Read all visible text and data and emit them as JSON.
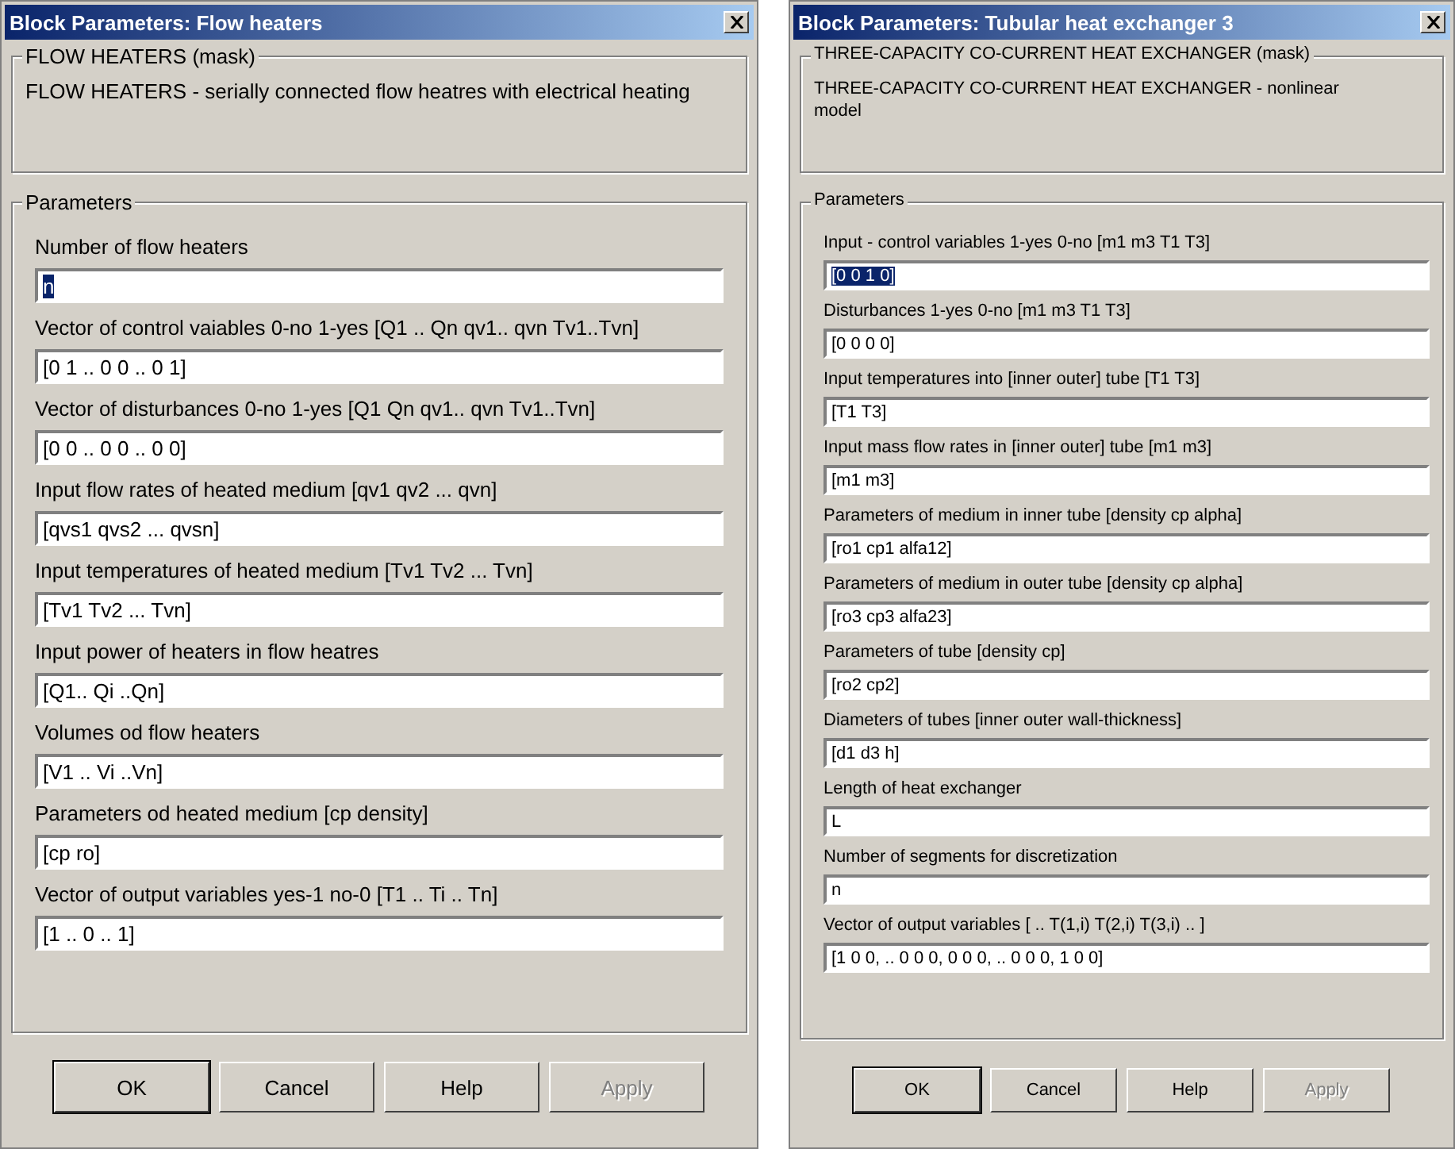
{
  "dialogs": [
    {
      "title": "Block Parameters: Flow heaters",
      "mask_title": "FLOW HEATERS (mask)",
      "mask_description": "FLOW HEATERS - serially connected flow heatres with electrical heating",
      "parameters_title": "Parameters",
      "parameters": [
        {
          "label": "Number of flow heaters",
          "value": "n",
          "text_selected": true
        },
        {
          "label": "Vector of control vaiables  0-no  1-yes [Q1 .. Qn qv1.. qvn Tv1..Tvn]",
          "value": "[0 1 .. 0 0 .. 0 1]",
          "text_selected": false
        },
        {
          "label": "Vector of disturbances  0-no 1-yes [Q1  Qn qv1.. qvn Tv1..Tvn]",
          "value": "[0 0 .. 0 0 .. 0 0]",
          "text_selected": false
        },
        {
          "label": "Input flow rates of heated medium   [qv1 qv2 ... qvn]",
          "value": "[qvs1 qvs2 ... qvsn]",
          "text_selected": false
        },
        {
          "label": "Input temperatures of heated medium    [Tv1 Tv2 ... Tvn]",
          "value": "[Tv1 Tv2 ... Tvn]",
          "text_selected": false
        },
        {
          "label": "Input power of heaters in flow heatres",
          "value": "[Q1.. Qi ..Qn]",
          "text_selected": false
        },
        {
          "label": "Volumes od flow heaters",
          "value": "[V1 .. Vi ..Vn]",
          "text_selected": false
        },
        {
          "label": "Parameters od heated medium   [cp  density]",
          "value": "[cp ro]",
          "text_selected": false
        },
        {
          "label": "Vector of output variables  yes-1  no-0   [T1 .. Ti .. Tn]",
          "value": "[1 .. 0 ..  1]",
          "text_selected": false
        }
      ],
      "buttons": [
        {
          "label": "OK",
          "disabled": false,
          "default": true
        },
        {
          "label": "Cancel",
          "disabled": false,
          "default": false
        },
        {
          "label": "Help",
          "disabled": false,
          "default": false
        },
        {
          "label": "Apply",
          "disabled": true,
          "default": false
        }
      ]
    },
    {
      "title": "Block Parameters: Tubular heat exchanger 3",
      "mask_title": "THREE-CAPACITY CO-CURRENT HEAT EXCHANGER  (mask)",
      "mask_description": "THREE-CAPACITY CO-CURRENT HEAT EXCHANGER - nonlinear model",
      "parameters_title": "Parameters",
      "parameters": [
        {
          "label": "Input - control variables   1-yes  0-no    [m1 m3 T1 T3]",
          "value": "[0 0 1 0]",
          "text_selected": true
        },
        {
          "label": "Disturbances    1-yes  0-no    [m1 m3 T1 T3]",
          "value": "[0 0 0 0]",
          "text_selected": false
        },
        {
          "label": "Input temperatures into [inner outer] tube  [T1    T3]",
          "value": "[T1 T3]",
          "text_selected": false
        },
        {
          "label": "Input mass flow rates in [inner outer] tube  [m1   m3]",
          "value": "[m1  m3]",
          "text_selected": false
        },
        {
          "label": "Parameters of medium in inner tube  [density  cp  alpha]",
          "value": "[ro1 cp1 alfa12]",
          "text_selected": false
        },
        {
          "label": "Parameters of medium in outer tube  [density  cp  alpha]",
          "value": "[ro3 cp3 alfa23]",
          "text_selected": false
        },
        {
          "label": "Parameters of tube [density  cp]",
          "value": "[ro2 cp2]",
          "text_selected": false
        },
        {
          "label": "Diameters of tubes   [inner outer wall-thickness]",
          "value": "[d1 d3 h]",
          "text_selected": false
        },
        {
          "label": "Length of heat exchanger",
          "value": "L",
          "text_selected": false
        },
        {
          "label": "Number of segments for discretization",
          "value": "n",
          "text_selected": false
        },
        {
          "label": "Vector of output variables    [ .. T(1,i)  T(2,i)  T(3,i) .. ]",
          "value": "[1 0 0, .. 0 0 0, 0 0 0, .. 0 0 0, 1 0 0]",
          "text_selected": false
        }
      ],
      "buttons": [
        {
          "label": "OK",
          "disabled": false,
          "default": true
        },
        {
          "label": "Cancel",
          "disabled": false,
          "default": false
        },
        {
          "label": "Help",
          "disabled": false,
          "default": false
        },
        {
          "label": "Apply",
          "disabled": true,
          "default": false
        }
      ]
    }
  ]
}
